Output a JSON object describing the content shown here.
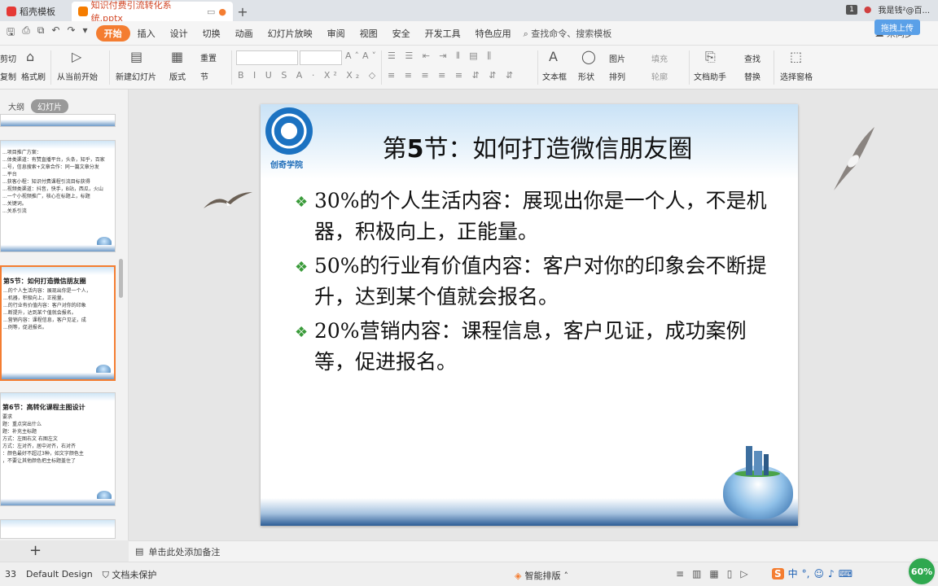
{
  "tabs": [
    {
      "label": "稻壳模板"
    },
    {
      "label": "知识付费引流转化系统.pptx"
    }
  ],
  "titlebar": {
    "window_count": "1",
    "user_label": "我是钱²@百...",
    "upload_button": "拖拽上传"
  },
  "menu": {
    "items": [
      "开始",
      "插入",
      "设计",
      "切换",
      "动画",
      "幻灯片放映",
      "审阅",
      "视图",
      "安全",
      "开发工具",
      "特色应用"
    ],
    "active": "开始",
    "search": "查找命令、搜索模板",
    "right": "未同步"
  },
  "ribbon": {
    "cut": "剪切",
    "copy": "复制",
    "format_painter": "格式刷",
    "from_current": "从当前开始",
    "new_slide": "新建幻灯片",
    "layout": "版式",
    "section": "节",
    "reset": "重置",
    "textbox": "文本框",
    "shape": "形状",
    "arrange": "排列",
    "picture": "图片",
    "fill": "填充",
    "outline": "轮廓",
    "doc_helper": "文档助手",
    "find": "查找",
    "replace": "替换",
    "select_pane": "选择窗格"
  },
  "leftpane": {
    "tab_outline": "大纲",
    "tab_slides": "幻灯片",
    "thumbs": [
      {
        "title": "",
        "lines": []
      },
      {
        "title": "",
        "lines": [
          "...项目推广方案：",
          "...体类渠道：有赞直播平台，头条，知乎，百家",
          "...号，信息搜索+文章合作：同一篇文章分发",
          "...平台",
          "...获客小程：知识付费课程引流目标获得",
          "...视频类渠道：抖音，快手，B站，西瓜，火山",
          "...一个小视频推广，核心在标题上，标题",
          "...关键词。",
          "...关系引流"
        ]
      },
      {
        "title": "第5节：如何打造微信朋友圈",
        "lines": [
          "...的个人生活内容：展现出你是一个人，",
          "...机器，积极向上，正能量。",
          "...的行业有价值内容：客户对你的印象",
          "...断提升，达到某个值就会报名。",
          "...营销内容：课程信息，客户见证，成",
          "...例等，促进报名。"
        ]
      },
      {
        "title": "第6节：高转化课程主图设计",
        "lines": [
          "要求",
          "题：重点突出什么",
          "题：补充主标题",
          "方式：左图右文 右图左文",
          "方式：左对齐，居中对齐，右对齐",
          "：颜色最好不超过3种，如文字颜色主",
          "，不要让其他颜色把主标题盖住了"
        ]
      },
      {
        "title": "",
        "lines": []
      }
    ]
  },
  "slide": {
    "logo_text": "创奇学院",
    "title_prefix": "第",
    "title_num": "5",
    "title_rest": "节：如何打造微信朋友圈",
    "bullets": [
      "30%的个人生活内容：展现出你是一个人，不是机器，积极向上，正能量。",
      "50%的行业有价值内容：客户对你的印象会不断提升，达到某个值就会报名。",
      "20%营销内容：课程信息，客户见证，成功案例等，促进报名。"
    ]
  },
  "notes": {
    "placeholder": "单击此处添加备注"
  },
  "status": {
    "slide_num": "33",
    "theme": "Default Design",
    "protect": "文档未保护",
    "smart_layout": "智能排版",
    "zoom": "60%"
  }
}
